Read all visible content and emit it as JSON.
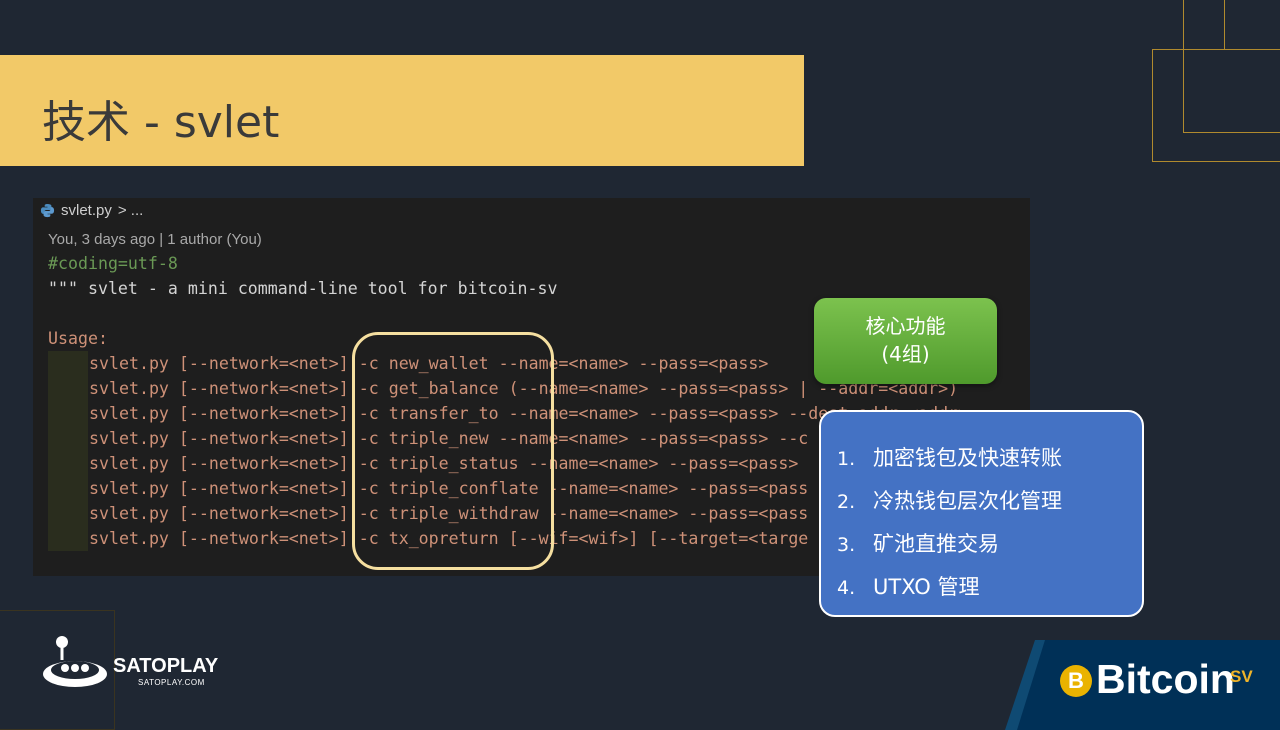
{
  "slide": {
    "title": "技术 - svlet"
  },
  "editor": {
    "breadcrumb_file": "svlet.py",
    "breadcrumb_rest": "> ...",
    "blame": "You, 3 days ago | 1 author (You)",
    "lines": [
      "#coding=utf-8",
      "\"\"\" svlet - a mini command-line tool for bitcoin-sv",
      "",
      "Usage:"
    ],
    "usage": [
      "svlet.py [--network=<net>] -c new_wallet --name=<name> --pass=<pass>",
      "svlet.py [--network=<net>] -c get_balance (--name=<name> --pass=<pass> | --addr=<addr>)",
      "svlet.py [--network=<net>] -c transfer_to --name=<name> --pass=<pass> --dest_addr=<addr>",
      "svlet.py [--network=<net>] -c triple_new --name=<name> --pass=<pass> --c",
      "svlet.py [--network=<net>] -c triple_status --name=<name> --pass=<pass>",
      "svlet.py [--network=<net>] -c triple_conflate --name=<name> --pass=<pass",
      "svlet.py [--network=<net>] -c triple_withdraw --name=<name> --pass=<pass",
      "svlet.py [--network=<net>] -c tx_opreturn [--wif=<wif>] [--target=<targe"
    ]
  },
  "callout": {
    "line1": "核心功能",
    "line2": "(4组)"
  },
  "features": [
    {
      "num": "1.",
      "text": "加密钱包及快速转账"
    },
    {
      "num": "2.",
      "text": "冷热钱包层次化管理"
    },
    {
      "num": "3.",
      "text": "矿池直推交易"
    },
    {
      "num": "4.",
      "text": "UTXO 管理"
    }
  ],
  "logos": {
    "satoplay_name": "SATOPLAY",
    "satoplay_url": "SATOPLAY.COM",
    "bitcoin_text": "Bitcoin",
    "bitcoin_sv": "SV",
    "coin_symbol": "B"
  },
  "colors": {
    "background": "#1f2733",
    "title_band": "#f2c968",
    "green": "#5aa632",
    "blue": "#4472c4"
  }
}
